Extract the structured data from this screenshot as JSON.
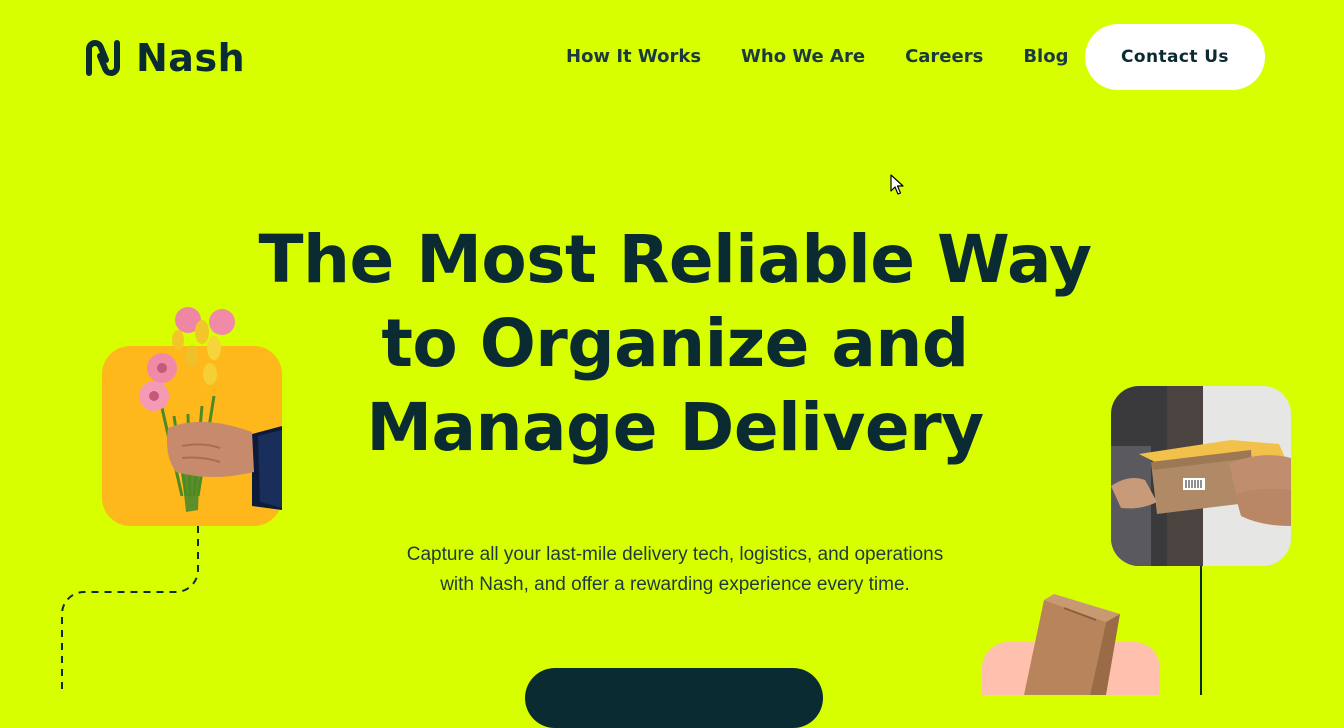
{
  "brand": {
    "name": "Nash",
    "logo_icon": "nash-logo-icon"
  },
  "nav": {
    "items": [
      "How It Works",
      "Who We Are",
      "Careers",
      "Blog"
    ],
    "contact_label": "Contact Us"
  },
  "hero": {
    "headline_lines": [
      "The Most Reliable Way",
      "to Organize and",
      "Manage Delivery"
    ],
    "subtext_lines": [
      "Capture all your last-mile delivery tech, logistics, and operations",
      "with Nash, and offer a rewarding experience every time."
    ]
  },
  "images": {
    "flowers": "hand-holding-flowers-image",
    "handover": "package-handover-image",
    "box": "cardboard-box-image"
  },
  "colors": {
    "background": "#d7ff00",
    "text": "#0b2b33",
    "orange_card": "#ffb81c",
    "pink_card": "#ffc1ae",
    "button_bg": "#ffffff",
    "cta_bg": "#0b2b33"
  }
}
